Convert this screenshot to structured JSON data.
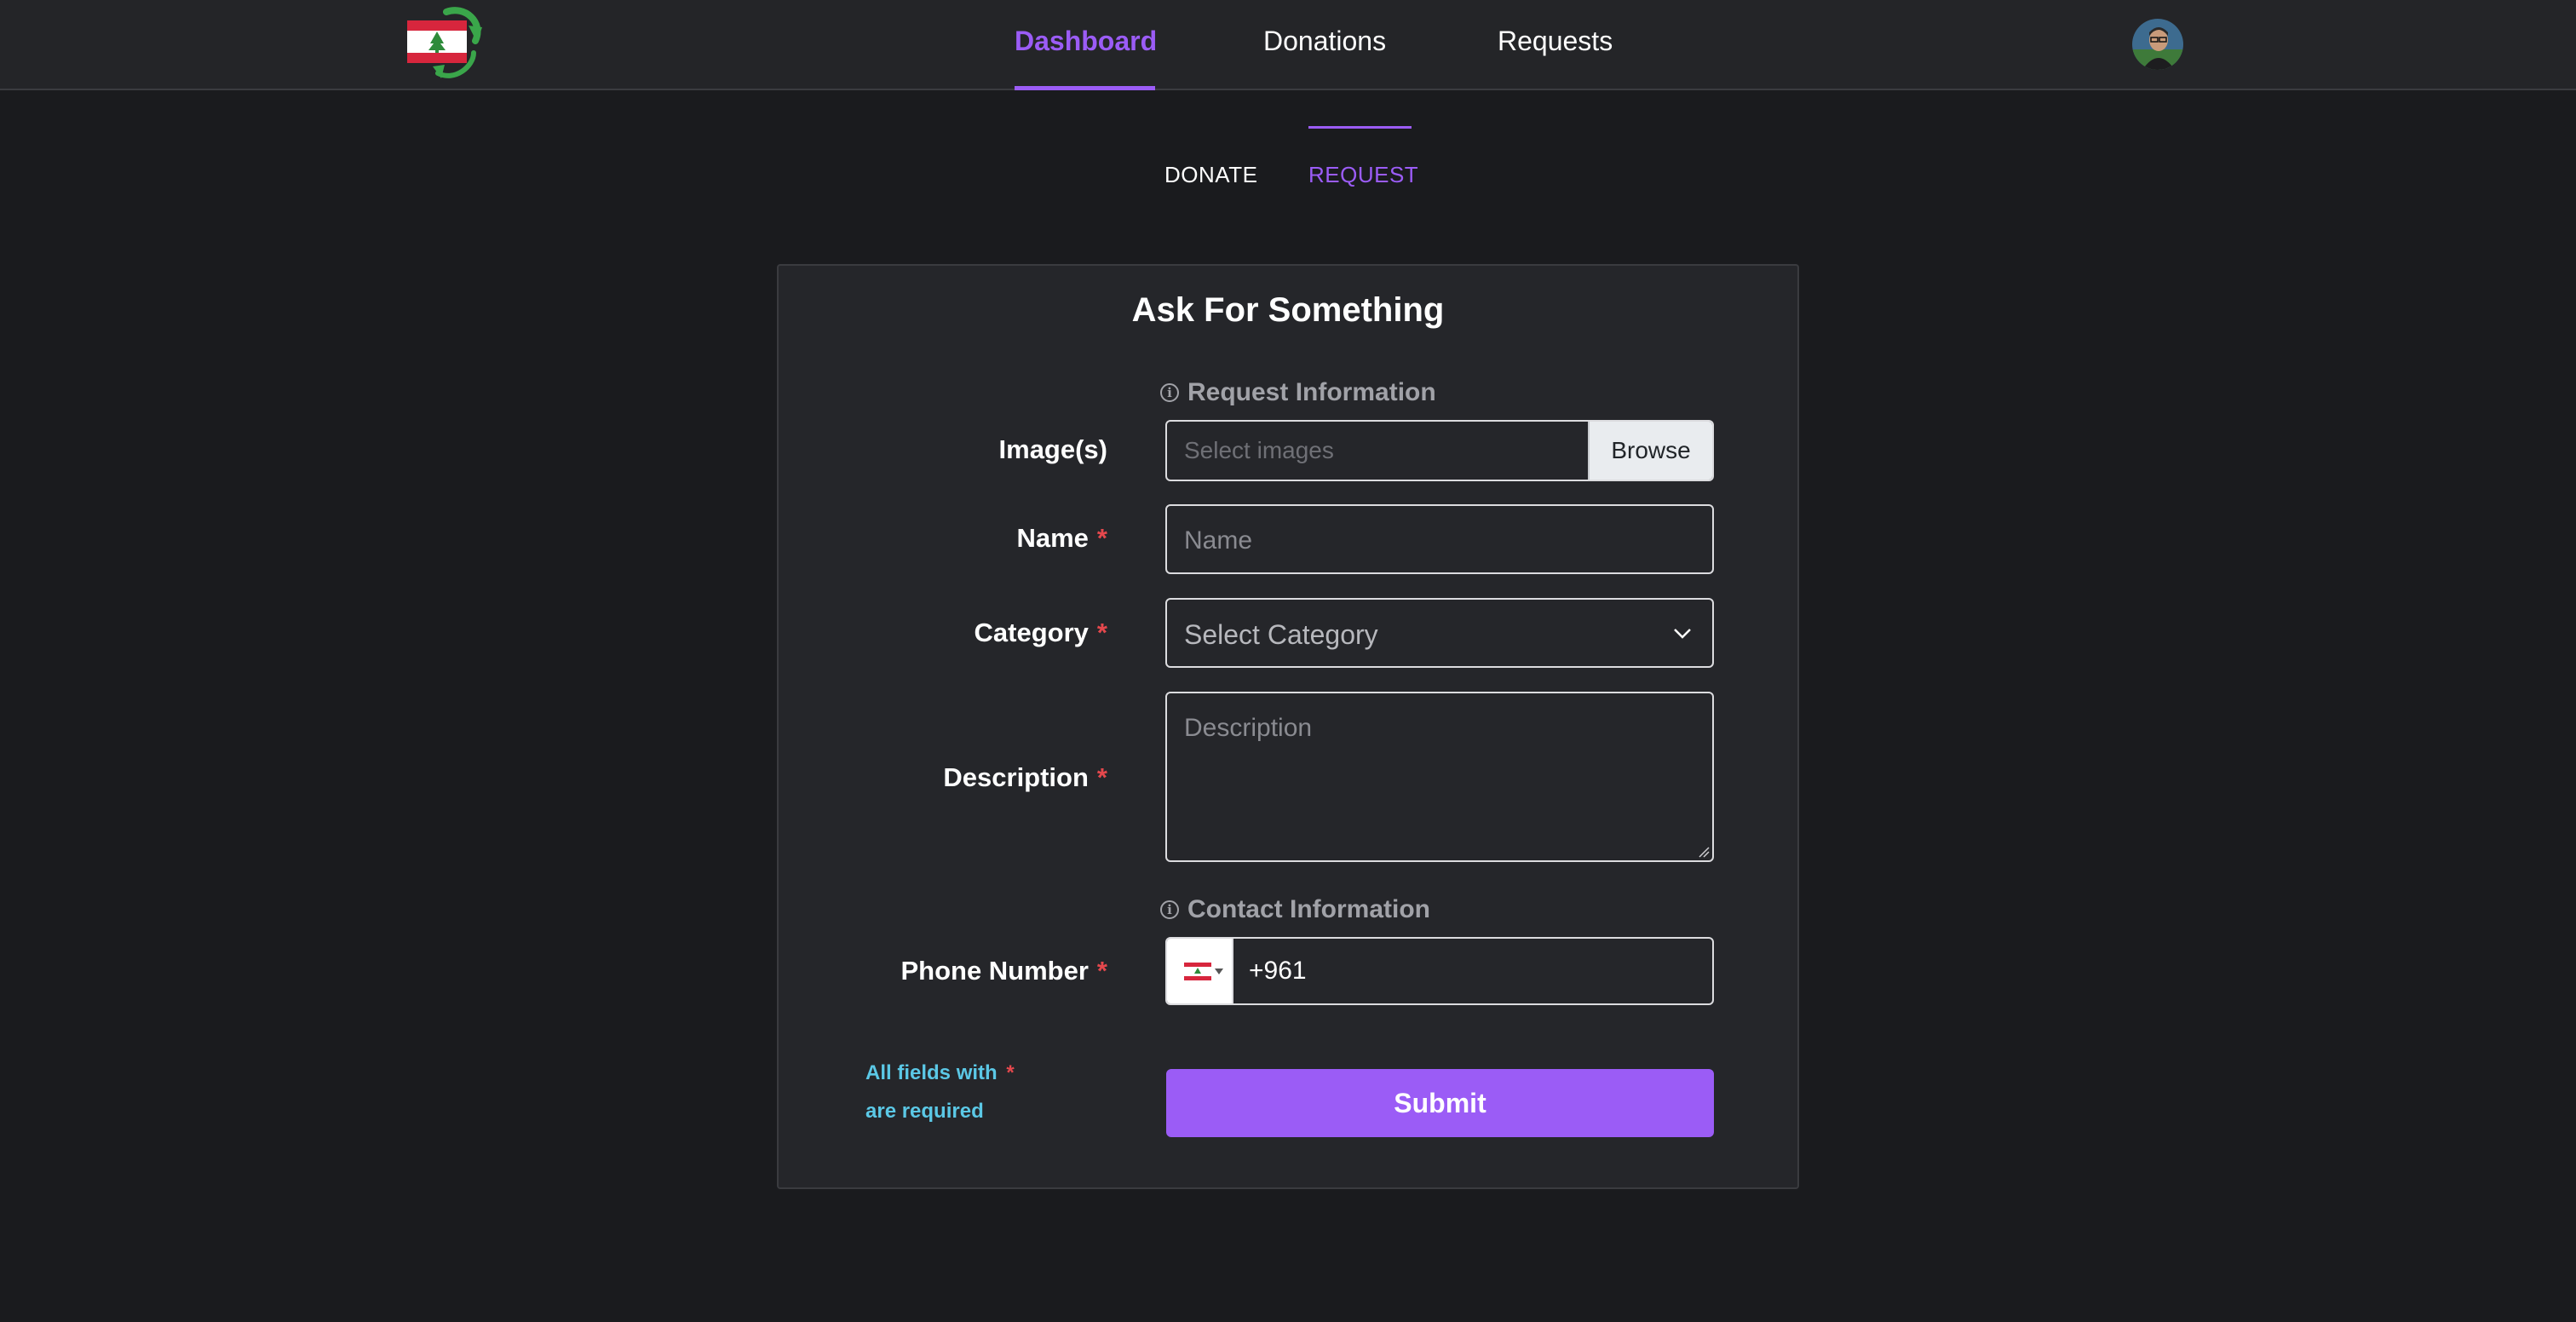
{
  "nav": {
    "items": [
      {
        "label": "Dashboard",
        "active": true
      },
      {
        "label": "Donations",
        "active": false
      },
      {
        "label": "Requests",
        "active": false
      }
    ]
  },
  "subtabs": {
    "donate": "DONATE",
    "request": "REQUEST",
    "active": "REQUEST"
  },
  "form": {
    "title": "Ask For Something",
    "sections": {
      "request_info": "Request Information",
      "contact_info": "Contact Information"
    },
    "fields": {
      "images": {
        "label": "Image(s)",
        "placeholder": "Select images",
        "button": "Browse"
      },
      "name": {
        "label": "Name",
        "placeholder": "Name",
        "required": "*"
      },
      "category": {
        "label": "Category",
        "selected": "Select Category",
        "required": "*"
      },
      "description": {
        "label": "Description",
        "placeholder": "Description",
        "required": "*"
      },
      "phone": {
        "label": "Phone Number",
        "value": "+961",
        "required": "*"
      }
    },
    "required_note": {
      "text": "All fields with",
      "marker": "*",
      "text2": "are required"
    },
    "submit": "Submit"
  },
  "colors": {
    "accent": "#9b5cf6",
    "background": "#1a1b1e",
    "card": "#25262a",
    "required": "#e5484d",
    "note": "#5bc8e6"
  }
}
